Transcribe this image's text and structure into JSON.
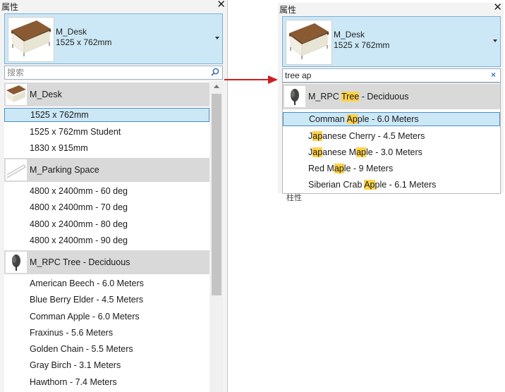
{
  "left_panel": {
    "title": "属性",
    "close_label": "✕",
    "type_selector": {
      "name": "M_Desk",
      "size": "1525 x 762mm"
    },
    "search": {
      "placeholder": "搜索",
      "value": ""
    },
    "groups": [
      {
        "name": "M_Desk",
        "thumb": "desk-thumbnail",
        "items": [
          "1525 x 762mm",
          "1525 x 762mm Student",
          "1830 x 915mm"
        ],
        "selected_index": 0
      },
      {
        "name": "M_Parking Space",
        "thumb": "parking-space-thumbnail",
        "items": [
          "4800 x 2400mm - 60 deg",
          "4800 x 2400mm - 70 deg",
          "4800 x 2400mm - 80 deg",
          "4800 x 2400mm - 90 deg"
        ],
        "selected_index": -1
      },
      {
        "name": "M_RPC Tree - Deciduous",
        "thumb": "tree-thumbnail",
        "items": [
          "American Beech - 6.0 Meters",
          "Blue Berry Elder - 4.5 Meters",
          "Comman Apple - 6.0 Meters",
          "Fraxinus - 5.6 Meters",
          "Golden Chain - 5.5 Meters",
          "Gray Birch - 3.1 Meters",
          "Hawthorn - 7.4 Meters"
        ],
        "selected_index": -1
      }
    ]
  },
  "right_panel": {
    "title": "属性",
    "close_label": "✕",
    "type_selector": {
      "name": "M_Desk",
      "size": "1525 x 762mm"
    },
    "search": {
      "value": "tree ap",
      "clear_label": "×"
    },
    "group": {
      "thumb": "tree-thumbnail",
      "parts": [
        "M_RPC ",
        "Tree",
        " - Deciduous"
      ]
    },
    "items": [
      {
        "parts": [
          "Comman ",
          "Ap",
          "ple - 6.0 Meters"
        ],
        "selected": true
      },
      {
        "parts": [
          "J",
          "ap",
          "anese Cherry - 4.5 Meters"
        ],
        "selected": false
      },
      {
        "parts": [
          "J",
          "ap",
          "anese M",
          "ap",
          "le - 3.0 Meters"
        ],
        "selected": false
      },
      {
        "parts": [
          "Red M",
          "ap",
          "le - 9 Meters"
        ],
        "selected": false
      },
      {
        "parts": [
          "Siberian Crab ",
          "Ap",
          "ple - 6.1 Meters"
        ],
        "selected": false
      }
    ],
    "peek_text": "柱性"
  },
  "colors": {
    "selection_bg": "#cce8f6",
    "selection_border": "#4a8fc9",
    "group_bg": "#d9d9d9",
    "highlight": "#ffd24a",
    "arrow": "#cc1f1f"
  }
}
